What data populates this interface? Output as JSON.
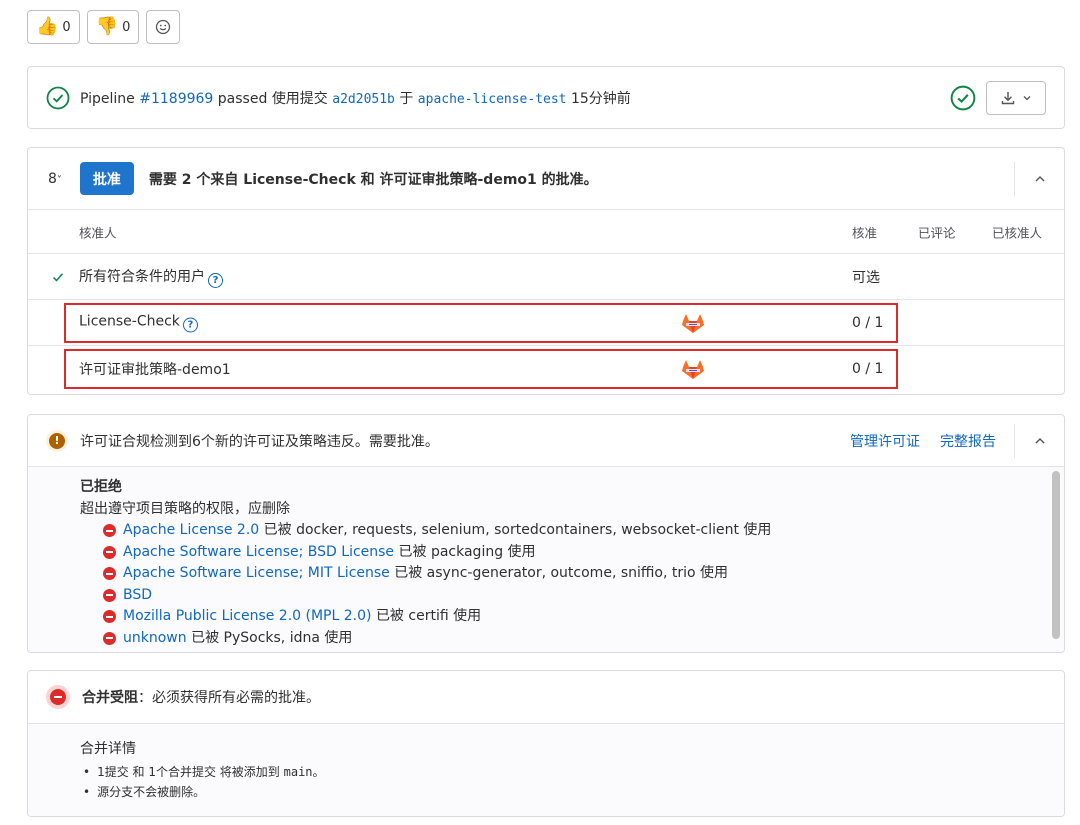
{
  "reactions": {
    "thumbs_up": {
      "icon": "thumbs-up-icon",
      "glyph": "👍",
      "count": "0"
    },
    "thumbs_down": {
      "icon": "thumbs-down-icon",
      "glyph": "👎",
      "count": "0"
    },
    "add_icon": "smiley-icon"
  },
  "pipeline": {
    "prefix": "Pipeline",
    "id": "#1189969",
    "status": "passed",
    "via_commit": "使用提交",
    "commit": "a2d2051b",
    "on": "于",
    "branch": "apache-license-test",
    "time": "15分钟前"
  },
  "approvals": {
    "count": "8",
    "approve_label": "批准",
    "message": "需要 2 个来自 License-Check 和 许可证审批策略-demo1 的批准。",
    "headers": {
      "approvers": "核准人",
      "approve": "核准",
      "commented": "已评论",
      "approved_by": "已核准人"
    },
    "rows": [
      {
        "name": "所有符合条件的用户",
        "value": "可选"
      },
      {
        "name": "License-Check",
        "value": "0 / 1"
      },
      {
        "name": "许可证审批策略-demo1",
        "value": "0 / 1"
      }
    ]
  },
  "license": {
    "message": "许可证合规检测到6个新的许可证及策略违反。需要批准。",
    "manage_link": "管理许可证",
    "report_link": "完整报告",
    "section_title": "已拒绝",
    "section_desc": "超出遵守项目策略的权限，应删除",
    "items": [
      {
        "name": "Apache License 2.0",
        "used": "已被 docker, requests, selenium, sortedcontainers, websocket-client 使用"
      },
      {
        "name": "Apache Software License; BSD License",
        "used": "已被 packaging 使用"
      },
      {
        "name": "Apache Software License; MIT License",
        "used": "已被 async-generator, outcome, sniffio, trio 使用"
      },
      {
        "name": "BSD",
        "used": ""
      },
      {
        "name": "Mozilla Public License 2.0 (MPL 2.0)",
        "used": "已被 certifi 使用"
      },
      {
        "name": "unknown",
        "used": "已被 PySocks, idna 使用"
      }
    ]
  },
  "merge": {
    "title_bold": "合并受阻",
    "title_rest": "：必须获得所有必需的批准。",
    "details_title": "合并详情",
    "detail_1_pre": "1提交 和 1个合并提交 将被添加到",
    "detail_1_branch": "main",
    "detail_1_post": "。",
    "detail_2": "源分支不会被删除。"
  }
}
